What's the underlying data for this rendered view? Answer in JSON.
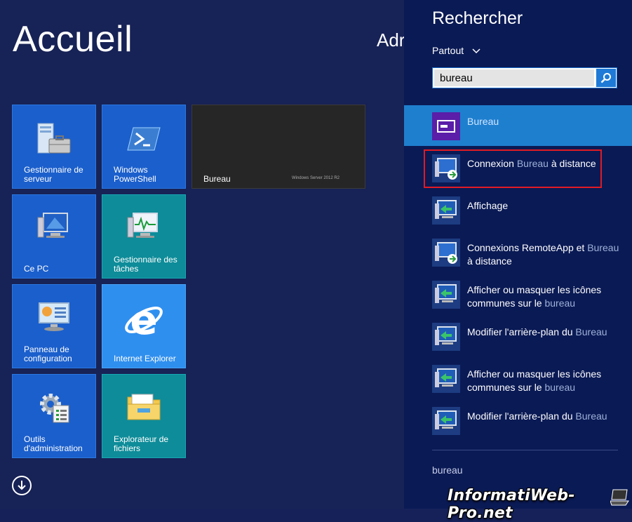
{
  "start": {
    "title": "Accueil",
    "user_partial": "Adr",
    "tiles": [
      {
        "label": "Gestionnaire de serveur",
        "icon": "server-manager-icon"
      },
      {
        "label": "Windows PowerShell",
        "icon": "powershell-icon"
      },
      {
        "label": "Bureau",
        "icon": "desktop-tile",
        "brand": "Windows Server 2012 R2"
      },
      {
        "label": "Ce PC",
        "icon": "computer-icon"
      },
      {
        "label": "Gestionnaire des tâches",
        "icon": "task-manager-icon"
      },
      {
        "label": "Panneau de configuration",
        "icon": "control-panel-icon"
      },
      {
        "label": "Internet Explorer",
        "icon": "internet-explorer-icon"
      },
      {
        "label": "Outils d'administration",
        "icon": "admin-tools-icon"
      },
      {
        "label": "Explorateur de fichiers",
        "icon": "file-explorer-icon"
      }
    ]
  },
  "search": {
    "title": "Rechercher",
    "scope": "Partout",
    "query": "bureau",
    "results": [
      {
        "parts": [
          {
            "t": "Bureau",
            "h": true
          }
        ],
        "icon": "desktop-icon",
        "selected": true
      },
      {
        "parts": [
          {
            "t": "Connexion ",
            "h": false
          },
          {
            "t": "Bureau",
            "h": true
          },
          {
            "t": " à distance",
            "h": false
          }
        ],
        "icon": "remote-desktop-icon",
        "selected": false
      },
      {
        "parts": [
          {
            "t": "Affichage",
            "h": false
          }
        ],
        "icon": "display-icon",
        "selected": false
      },
      {
        "parts": [
          {
            "t": "Connexions RemoteApp et ",
            "h": false
          },
          {
            "t": "Bureau",
            "h": true
          },
          {
            "t": " à distance",
            "h": false
          }
        ],
        "icon": "remoteapp-icon",
        "selected": false
      },
      {
        "parts": [
          {
            "t": "Afficher ou masquer les icônes communes sur le ",
            "h": false
          },
          {
            "t": "bureau",
            "h": true
          }
        ],
        "icon": "display-icon",
        "selected": false
      },
      {
        "parts": [
          {
            "t": "Modifier l'arrière-plan du ",
            "h": false
          },
          {
            "t": "Bureau",
            "h": true
          }
        ],
        "icon": "display-icon",
        "selected": false
      },
      {
        "parts": [
          {
            "t": "Afficher ou masquer les icônes communes sur le ",
            "h": false
          },
          {
            "t": "bureau",
            "h": true
          }
        ],
        "icon": "display-icon",
        "selected": false
      },
      {
        "parts": [
          {
            "t": "Modifier l'arrière-plan du ",
            "h": false
          },
          {
            "t": "Bureau",
            "h": true
          }
        ],
        "icon": "display-icon",
        "selected": false
      }
    ],
    "footer_query": "bureau"
  },
  "watermark": "InformatiWeb-Pro.net",
  "colors": {
    "start_bg": "#172256",
    "pane_bg": "#0a1a55",
    "selected": "#1f7fcf",
    "highlight_box": "#e01b24"
  }
}
